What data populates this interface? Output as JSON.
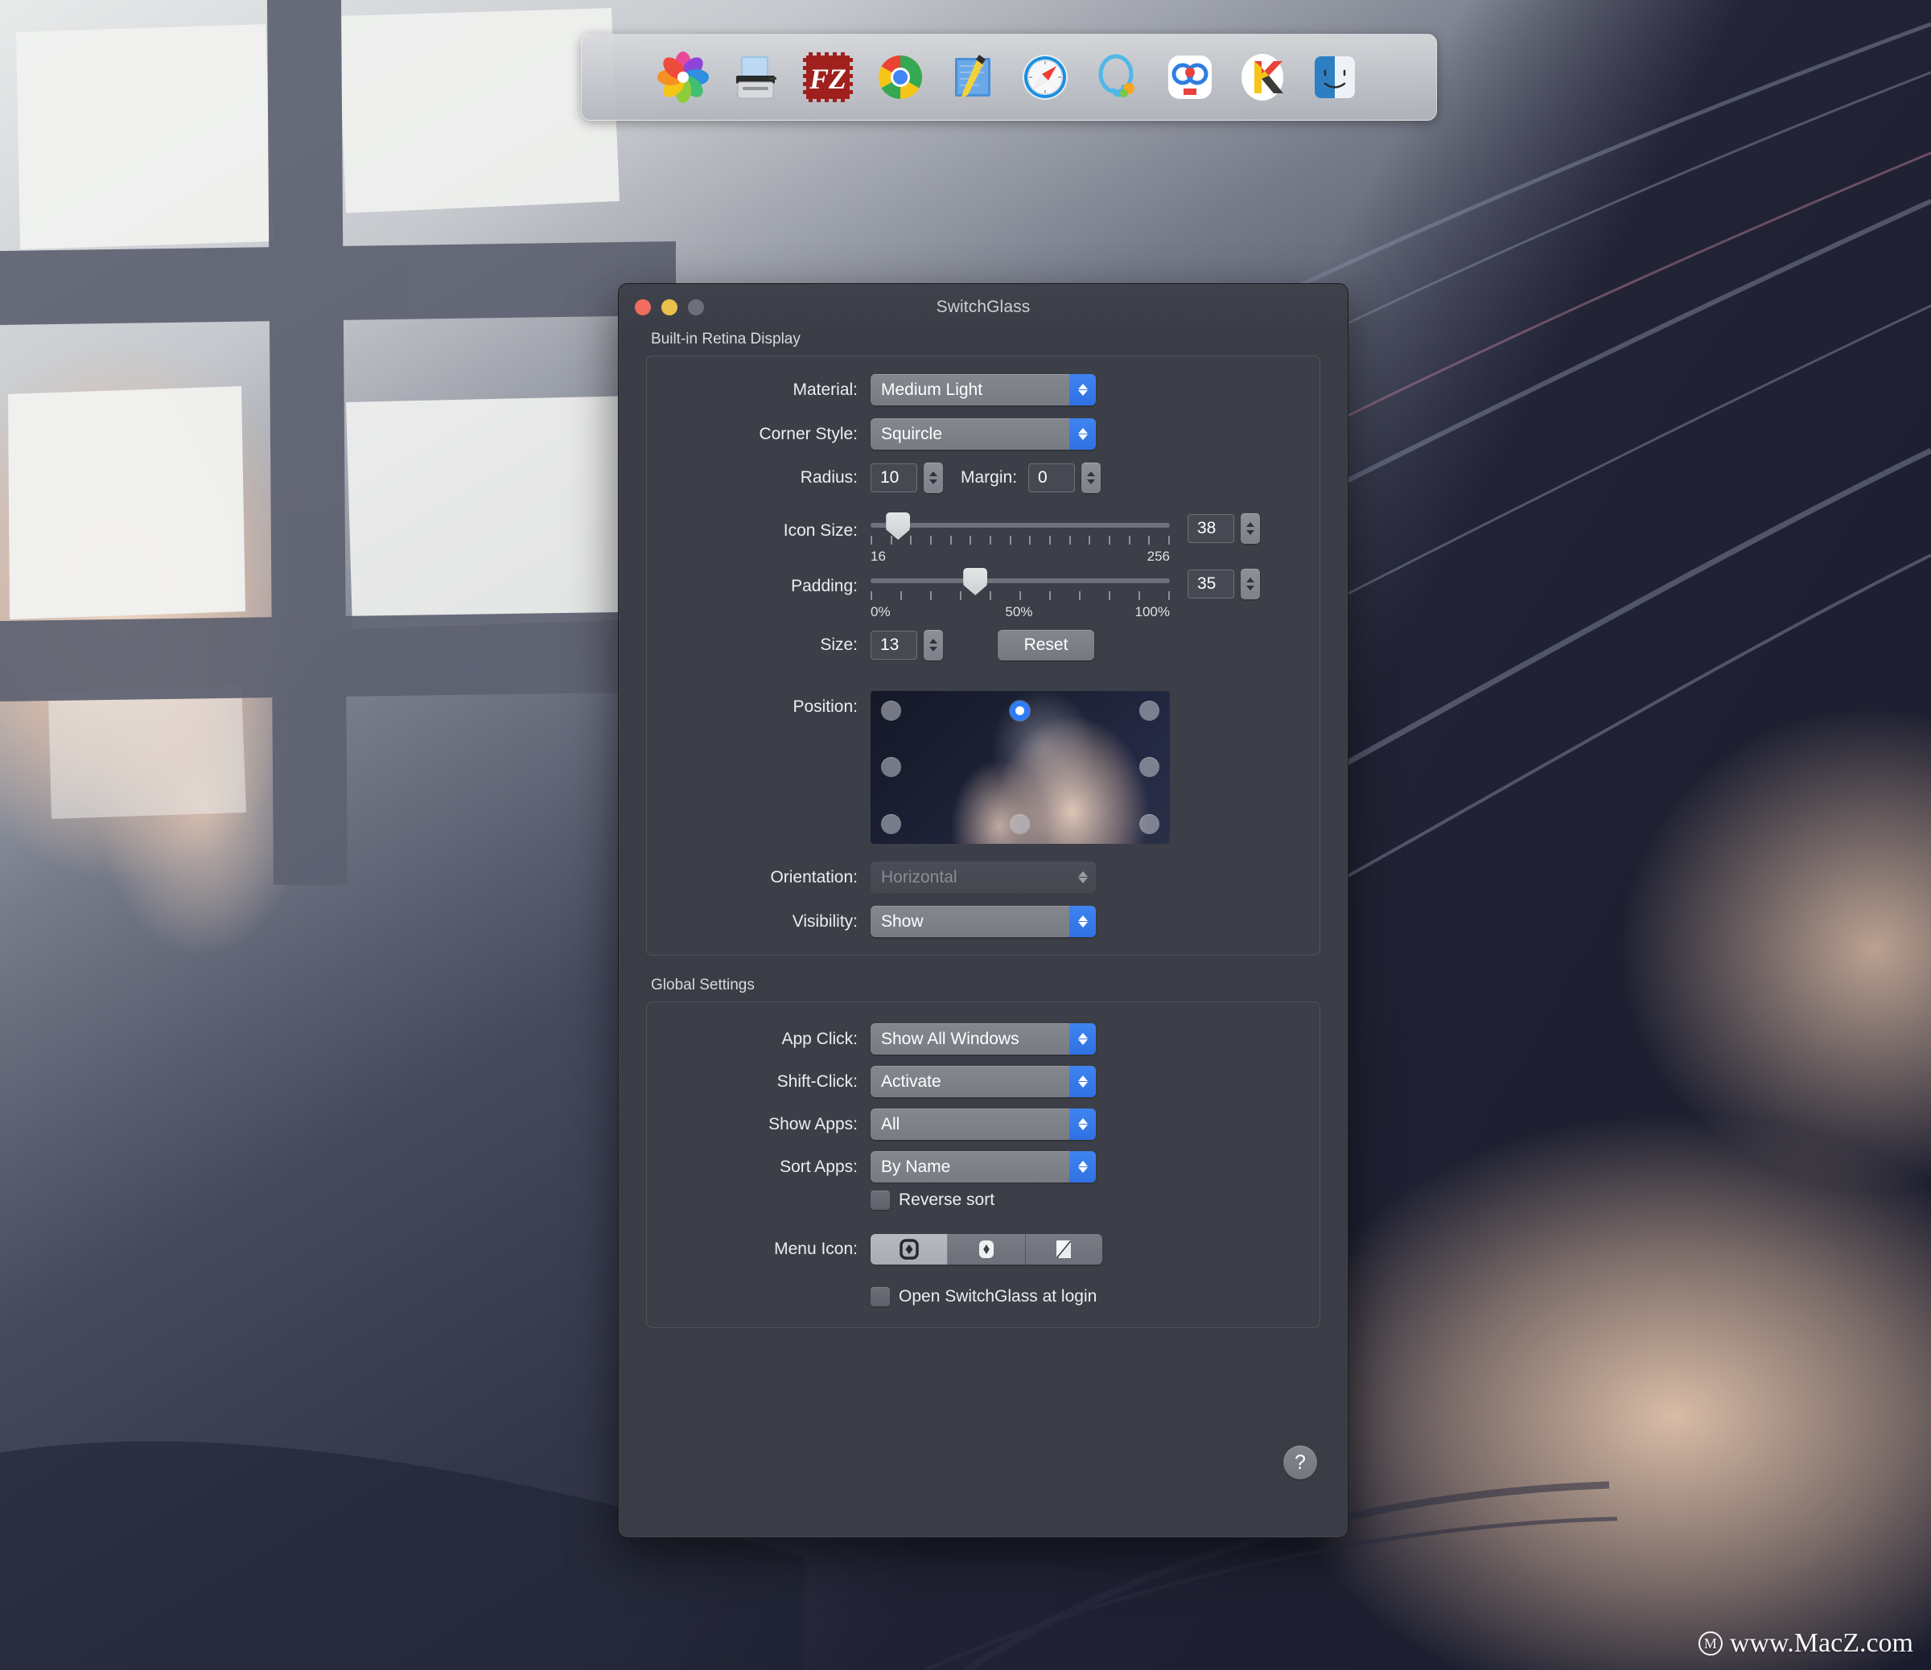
{
  "dock": {
    "name": "dock",
    "items": [
      {
        "name": "photos-app-icon",
        "label": "Photos"
      },
      {
        "name": "scanner-app-icon",
        "label": "Image Capture"
      },
      {
        "name": "filezilla-app-icon",
        "label": "FileZilla",
        "text": "FZ"
      },
      {
        "name": "chrome-app-icon",
        "label": "Google Chrome"
      },
      {
        "name": "notes-sketch-app-icon",
        "label": "Notes"
      },
      {
        "name": "safari-app-icon",
        "label": "Safari"
      },
      {
        "name": "qq-app-icon",
        "label": "QQ"
      },
      {
        "name": "baidu-netdisk-app-icon",
        "label": "Baidu Netdisk"
      },
      {
        "name": "kindle-app-icon",
        "label": "Kindle",
        "text": "K"
      },
      {
        "name": "finder-app-icon",
        "label": "Finder"
      }
    ]
  },
  "window": {
    "title": "SwitchGlass",
    "traffic_lights": {
      "close": "close",
      "minimize": "minimize",
      "zoom": "zoom"
    }
  },
  "display_group": {
    "label": "Built-in Retina Display",
    "material": {
      "label": "Material:",
      "value": "Medium Light"
    },
    "corner_style": {
      "label": "Corner Style:",
      "value": "Squircle"
    },
    "radius": {
      "label": "Radius:",
      "value": "10"
    },
    "margin": {
      "label": "Margin:",
      "value": "0"
    },
    "icon_size": {
      "label": "Icon Size:",
      "value": "38",
      "min_label": "16",
      "max_label": "256",
      "min": 16,
      "max": 256,
      "ticks": 16,
      "percent": 9.2
    },
    "padding": {
      "label": "Padding:",
      "value": "35",
      "min_label": "0%",
      "mid_label": "50%",
      "max_label": "100%",
      "min": 0,
      "max": 100,
      "ticks": 11,
      "percent": 35
    },
    "size": {
      "label": "Size:",
      "value": "13"
    },
    "reset": {
      "label": "Reset"
    },
    "position": {
      "label": "Position:",
      "selected": "top-center",
      "dots": [
        "top-left",
        "top-center",
        "top-right",
        "middle-left",
        "middle-right",
        "bottom-left",
        "bottom-center",
        "bottom-right"
      ]
    },
    "orientation": {
      "label": "Orientation:",
      "value": "Horizontal",
      "disabled": true
    },
    "visibility": {
      "label": "Visibility:",
      "value": "Show"
    }
  },
  "global_group": {
    "label": "Global Settings",
    "app_click": {
      "label": "App Click:",
      "value": "Show All Windows"
    },
    "shift_click": {
      "label": "Shift-Click:",
      "value": "Activate"
    },
    "show_apps": {
      "label": "Show Apps:",
      "value": "All"
    },
    "sort_apps": {
      "label": "Sort Apps:",
      "value": "By Name"
    },
    "reverse_sort": {
      "label": "Reverse sort",
      "checked": false
    },
    "menu_icon": {
      "label": "Menu Icon:",
      "selected_index": 0,
      "options": [
        {
          "name": "menu-icon-outline-diamond"
        },
        {
          "name": "menu-icon-filled-diamond"
        },
        {
          "name": "menu-icon-split-square"
        }
      ]
    },
    "open_at_login": {
      "label": "Open SwitchGlass at login",
      "checked": false
    },
    "help": {
      "label": "?"
    }
  },
  "watermark": {
    "logo": "M",
    "text": "www.MacZ.com"
  },
  "colors": {
    "accent_blue": "#2f71e3",
    "window_bg": "#3a3d46",
    "control_gray": "#7b7e86",
    "text": "#eceef0"
  }
}
